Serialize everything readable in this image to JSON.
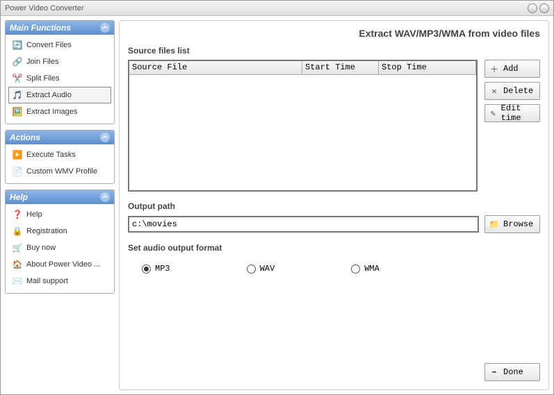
{
  "titlebar": {
    "title": "Power Video Converter"
  },
  "sidebar": {
    "main_functions_hdr": "Main Functions",
    "main_functions": [
      {
        "label": "Convert Files"
      },
      {
        "label": "Join Files"
      },
      {
        "label": "Split Files"
      },
      {
        "label": "Extract Audio"
      },
      {
        "label": "Extract Images"
      }
    ],
    "actions_hdr": "Actions",
    "actions": [
      {
        "label": "Execute Tasks"
      },
      {
        "label": "Custom WMV Profile"
      }
    ],
    "help_hdr": "Help",
    "help": [
      {
        "label": "Help"
      },
      {
        "label": "Registration"
      },
      {
        "label": "Buy now"
      },
      {
        "label": "About Power Video ..."
      },
      {
        "label": "Mail support"
      }
    ]
  },
  "content": {
    "page_title": "Extract WAV/MP3/WMA from video files",
    "source_list_label": "Source files list",
    "columns": {
      "c1": "Source File",
      "c2": "Start Time",
      "c3": "Stop Time"
    },
    "buttons": {
      "add": "Add",
      "delete": "Delete",
      "edit_time": "Edit time",
      "browse": "Browse",
      "done": "Done"
    },
    "output_path_label": "Output path",
    "output_path_value": "c:\\movies",
    "format_label": "Set audio output format",
    "formats": {
      "mp3": "MP3",
      "wav": "WAV",
      "wma": "WMA"
    }
  }
}
